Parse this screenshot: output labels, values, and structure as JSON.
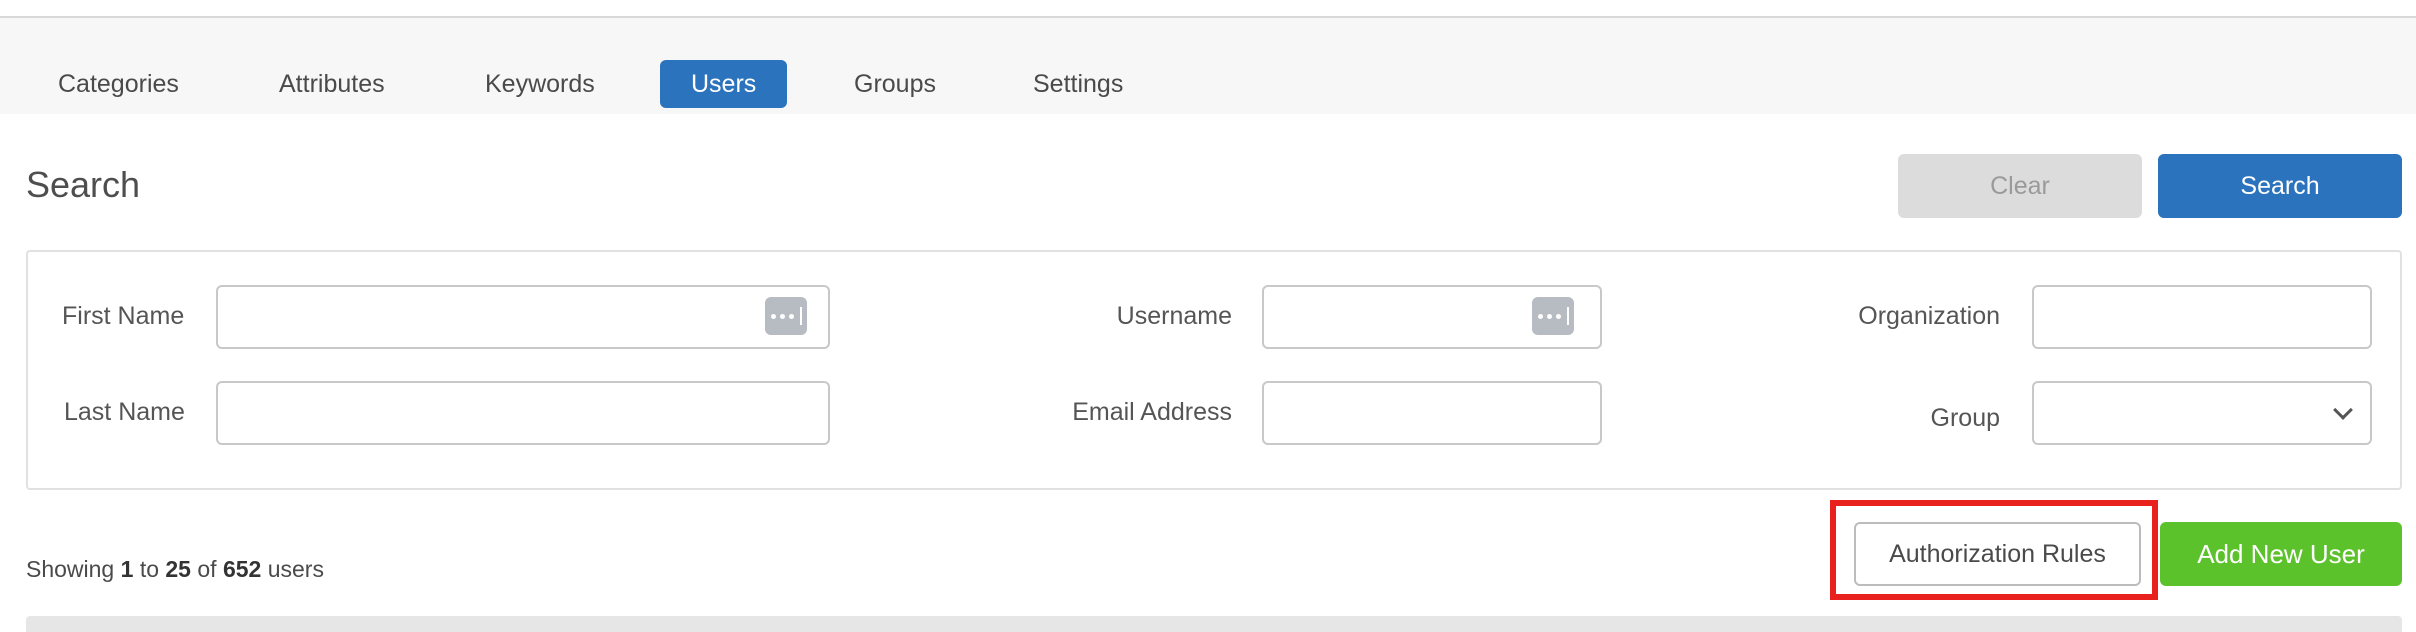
{
  "nav": {
    "tabs": [
      "Categories",
      "Attributes",
      "Keywords",
      "Users",
      "Groups",
      "Settings"
    ],
    "active_tab": "Users"
  },
  "search": {
    "title": "Search",
    "clear_label": "Clear",
    "search_label": "Search",
    "fields": {
      "first_name": {
        "label": "First Name",
        "value": ""
      },
      "last_name": {
        "label": "Last Name",
        "value": ""
      },
      "username": {
        "label": "Username",
        "value": ""
      },
      "email": {
        "label": "Email Address",
        "value": ""
      },
      "organization": {
        "label": "Organization",
        "value": ""
      },
      "group": {
        "label": "Group",
        "selected": ""
      }
    }
  },
  "results": {
    "prefix": "Showing",
    "from": "1",
    "to_word": "to",
    "to": "25",
    "of_word": "of",
    "total": "652",
    "suffix": "users"
  },
  "actions": {
    "authorization_rules_label": "Authorization Rules",
    "add_new_user_label": "Add New User"
  },
  "icons": {
    "password_manager": "password-manager-icon",
    "select_arrow": "chevron-down-icon"
  },
  "colors": {
    "primary": "#2c73bd",
    "success": "#5cc22b",
    "highlight": "#e8211c",
    "disabled": "#dcdcdc"
  }
}
